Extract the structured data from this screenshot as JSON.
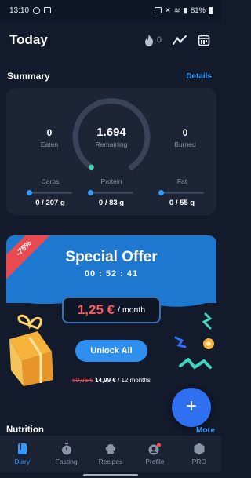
{
  "status_bar": {
    "time": "13:10",
    "battery": "81%"
  },
  "header": {
    "title": "Today",
    "streak_count": "0",
    "icons": [
      "flame-icon",
      "trend-chart-icon",
      "calendar-icon"
    ]
  },
  "summary": {
    "title": "Summary",
    "details_label": "Details",
    "eaten_value": "0",
    "eaten_label": "Eaten",
    "remaining_value": "1.694",
    "remaining_label": "Remaining",
    "burned_value": "0",
    "burned_label": "Burned",
    "macros": [
      {
        "label": "Carbs",
        "value": "0 / 207 g",
        "progress": 0
      },
      {
        "label": "Protein",
        "value": "0 / 83 g",
        "progress": 0
      },
      {
        "label": "Fat",
        "value": "0 / 55 g",
        "progress": 0
      }
    ]
  },
  "offer": {
    "discount": "-75%",
    "title": "Special Offer",
    "timer": "00 : 52 : 41",
    "price": "1,25 €",
    "price_unit": "/ month",
    "button_label": "Unlock All",
    "old_price": "59,96 €",
    "new_price": "14,99 €",
    "period": "/ 12 months"
  },
  "fab_label": "+",
  "nutrition": {
    "title": "Nutrition",
    "more_label": "More"
  },
  "tabs": [
    {
      "label": "Diary",
      "icon": "diary-icon",
      "active": true
    },
    {
      "label": "Fasting",
      "icon": "stopwatch-icon",
      "active": false
    },
    {
      "label": "Recipes",
      "icon": "chef-hat-icon",
      "active": false
    },
    {
      "label": "Profile",
      "icon": "profile-icon",
      "active": false
    },
    {
      "label": "PRO",
      "icon": "pro-badge-icon",
      "active": false
    }
  ],
  "colors": {
    "background": "#121a2b",
    "card": "#1c2436",
    "accent": "#2f9bff",
    "offer_blue": "#1e78d0",
    "sale_red": "#e84a4f"
  }
}
